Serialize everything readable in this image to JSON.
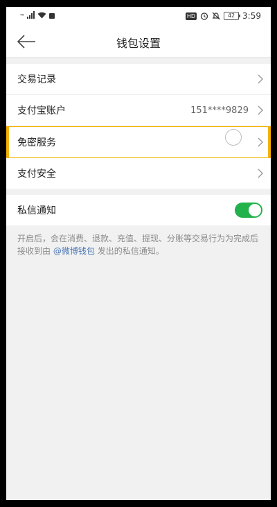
{
  "status_bar": {
    "network_label": "⁴⁶",
    "hd_label": "HD",
    "battery_level": "42",
    "time": "3:59"
  },
  "nav": {
    "title": "钱包设置"
  },
  "settings_group_1": [
    {
      "label": "交易记录",
      "value": ""
    },
    {
      "label": "支付宝账户",
      "value": "151****9829"
    },
    {
      "label": "免密服务",
      "value": ""
    },
    {
      "label": "支付安全",
      "value": ""
    }
  ],
  "notification": {
    "label": "私信通知",
    "enabled": true,
    "note_before": "开启后，会在消费、退款、充值、提现、分账等交易行为为完成后接收到由",
    "note_link": "@微博钱包",
    "note_after": "发出的私信通知。"
  },
  "colors": {
    "toggle_on": "#21b24c",
    "highlight": "#f5b300",
    "link": "#4a77b5"
  }
}
